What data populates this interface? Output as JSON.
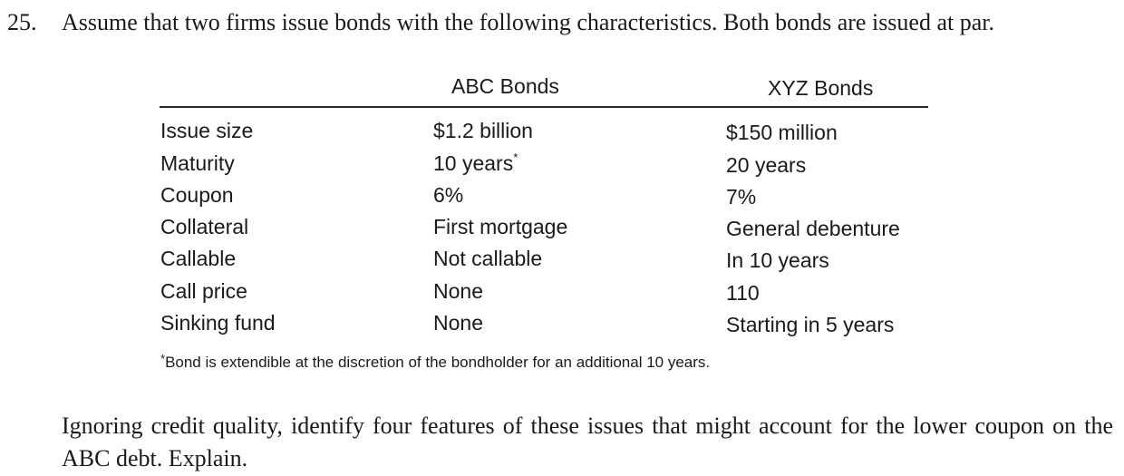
{
  "question": {
    "number": "25.",
    "stem": "Assume that two firms issue bonds with the following characteristics. Both bonds are issued at par."
  },
  "table": {
    "columns": [
      "ABC Bonds",
      "XYZ Bonds"
    ],
    "rows": [
      {
        "label": "Issue size",
        "abc": "$1.2 billion",
        "xyz": "$150 million"
      },
      {
        "label": "Maturity",
        "abc": "10 years",
        "abc_mark": "*",
        "xyz": "20 years"
      },
      {
        "label": "Coupon",
        "abc": "6%",
        "xyz": "7%"
      },
      {
        "label": "Collateral",
        "abc": "First mortgage",
        "xyz": "General debenture"
      },
      {
        "label": "Callable",
        "abc": "Not callable",
        "xyz": "In 10 years"
      },
      {
        "label": "Call price",
        "abc": "None",
        "xyz": "110"
      },
      {
        "label": "Sinking fund",
        "abc": "None",
        "xyz": "Starting in 5 years"
      }
    ],
    "footnote_mark": "*",
    "footnote": "Bond is extendible at the discretion of the bondholder for an additional 10 years."
  },
  "follow_up": "Ignoring credit quality, identify four features of these issues that might account for the lower coupon on the ABC debt. Explain."
}
